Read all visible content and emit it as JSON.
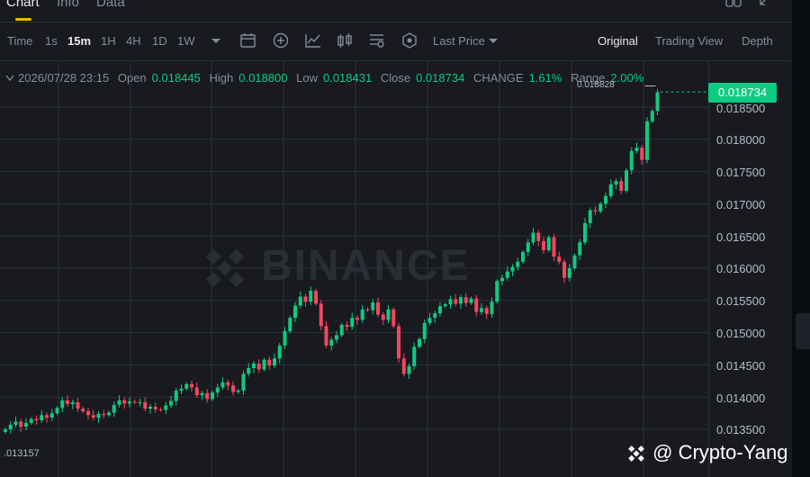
{
  "tabs": [
    "Chart",
    "Info",
    "Data"
  ],
  "toolbar": {
    "time_label": "Time",
    "intervals": [
      "1s",
      "15m",
      "1H",
      "4H",
      "1D",
      "1W"
    ],
    "active_interval": "15m",
    "price_type": "Last Price",
    "views": [
      "Original",
      "Trading View",
      "Depth"
    ],
    "active_view": "Original"
  },
  "ohlc": {
    "datetime": "2026/07/28 23:15",
    "open_label": "Open",
    "open": "0.018445",
    "high_label": "High",
    "high": "0.018800",
    "low_label": "Low",
    "low": "0.018431",
    "close_label": "Close",
    "close": "0.018734",
    "change_label": "CHANGE",
    "change": "1.61%",
    "range_label": "Range",
    "range": "2.00%"
  },
  "price_axis": {
    "current_price": "0.018734",
    "ticks": [
      "0.018500",
      "0.018000",
      "0.017500",
      "0.017000",
      "0.016500",
      "0.016000",
      "0.015500",
      "0.015000",
      "0.014500",
      "0.014000",
      "0.013500"
    ]
  },
  "markers": {
    "high_label": "0.018828",
    "low_label": ".013157"
  },
  "watermark": "BINANCE",
  "signature": "@ Crypto-Yang",
  "colors": {
    "up": "#0ecb81",
    "down": "#f6465d",
    "bg": "#181a20",
    "grid": "#2b3139"
  },
  "chart_data": {
    "type": "candlestick",
    "ylim": [
      0.0132,
      0.0189
    ],
    "grid": true,
    "closes": [
      0.0135,
      0.01357,
      0.01362,
      0.01354,
      0.0136,
      0.01366,
      0.01364,
      0.01372,
      0.01368,
      0.01375,
      0.01383,
      0.01395,
      0.01389,
      0.01392,
      0.01382,
      0.01378,
      0.01372,
      0.01368,
      0.01374,
      0.01372,
      0.01376,
      0.01388,
      0.01395,
      0.0139,
      0.01393,
      0.01392,
      0.01392,
      0.01382,
      0.01385,
      0.01381,
      0.0138,
      0.01387,
      0.01394,
      0.0141,
      0.01413,
      0.0142,
      0.01415,
      0.01403,
      0.01406,
      0.01397,
      0.01407,
      0.01415,
      0.01423,
      0.01418,
      0.01408,
      0.0141,
      0.01436,
      0.01445,
      0.01452,
      0.01443,
      0.01458,
      0.01449,
      0.0146,
      0.0148,
      0.01502,
      0.01523,
      0.01542,
      0.01556,
      0.01548,
      0.01565,
      0.01545,
      0.0151,
      0.0148,
      0.01489,
      0.01496,
      0.01512,
      0.01509,
      0.01523,
      0.0152,
      0.01536,
      0.01535,
      0.01547,
      0.01528,
      0.0152,
      0.01536,
      0.0151,
      0.0146,
      0.01436,
      0.01448,
      0.01478,
      0.0149,
      0.01515,
      0.01523,
      0.0153,
      0.01541,
      0.01544,
      0.01552,
      0.01545,
      0.01555,
      0.01546,
      0.01553,
      0.01532,
      0.01538,
      0.01529,
      0.01548,
      0.0158,
      0.01585,
      0.01595,
      0.01602,
      0.0161,
      0.01625,
      0.0164,
      0.01655,
      0.01642,
      0.01628,
      0.01648,
      0.01618,
      0.0161,
      0.01585,
      0.016,
      0.0162,
      0.0164,
      0.0167,
      0.0169,
      0.01688,
      0.017,
      0.01712,
      0.0173,
      0.01735,
      0.0172,
      0.01752,
      0.01782,
      0.01787,
      0.01768,
      0.01828,
      0.01844,
      0.01873
    ]
  }
}
